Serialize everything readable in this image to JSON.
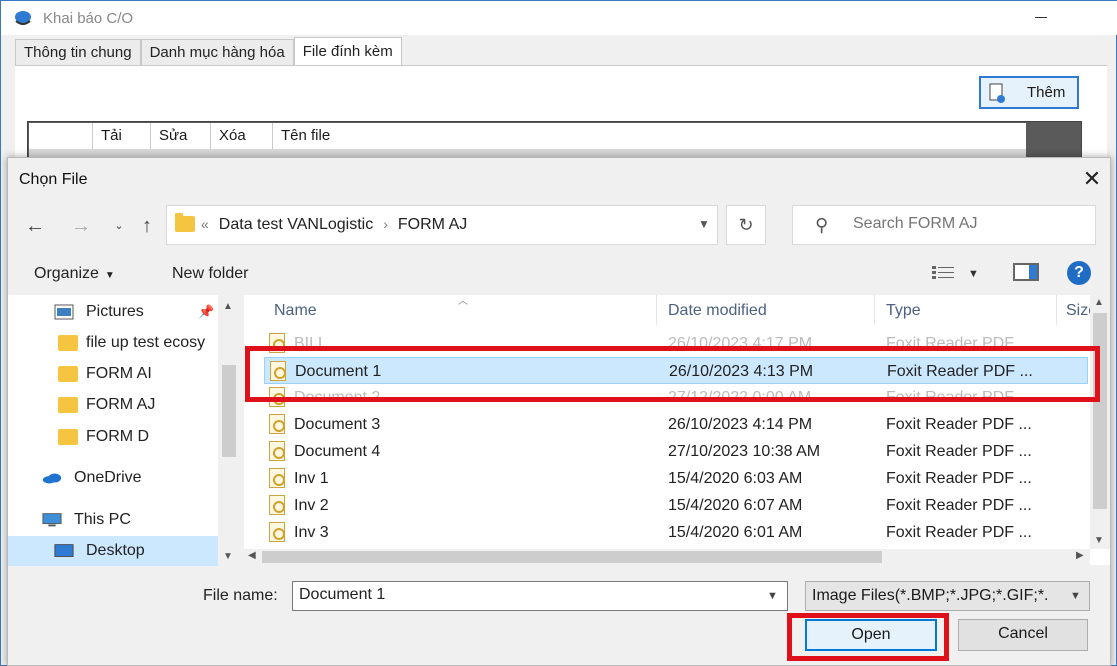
{
  "background_window": {
    "title": "Khai báo C/O",
    "tabs": [
      "Thông tin chung",
      "Danh mục hàng hóa",
      "File đính kèm"
    ],
    "add_button_label": "Thêm",
    "table_headers": [
      "Tải",
      "Sửa",
      "Xóa",
      "Tên file"
    ]
  },
  "dialog": {
    "title": "Chọn File",
    "address": {
      "prefix": "«",
      "parts": [
        "Data test VANLogistic",
        "FORM AJ"
      ],
      "separator": "›"
    },
    "search_placeholder": "Search FORM AJ",
    "toolbar": {
      "organize": "Organize",
      "new_folder": "New folder"
    },
    "nav_items": [
      {
        "label": "Pictures",
        "icon": "pictures-icon",
        "pinned": true
      },
      {
        "label": "file up test ecosy",
        "icon": "folder-icon"
      },
      {
        "label": "FORM AI",
        "icon": "folder-icon"
      },
      {
        "label": "FORM AJ",
        "icon": "folder-icon"
      },
      {
        "label": "FORM D",
        "icon": "folder-icon"
      },
      {
        "label": "OneDrive",
        "icon": "onedrive-icon"
      },
      {
        "label": "This PC",
        "icon": "this-pc-icon"
      },
      {
        "label": "Desktop",
        "icon": "desktop-icon",
        "selected": true
      }
    ],
    "columns": [
      "Name",
      "Date modified",
      "Type",
      "Size"
    ],
    "files": [
      {
        "name": "BILL",
        "date": "26/10/2023 4:17 PM",
        "type": "Foxit Reader PDF ...",
        "faded": true
      },
      {
        "name": "Document 1",
        "date": "26/10/2023 4:13 PM",
        "type": "Foxit Reader PDF ...",
        "selected": true
      },
      {
        "name": "Document 2",
        "date": "27/12/2022 0:00 AM",
        "type": "Foxit Reader PDF ...",
        "faded": true
      },
      {
        "name": "Document 3",
        "date": "26/10/2023 4:14 PM",
        "type": "Foxit Reader PDF ..."
      },
      {
        "name": "Document 4",
        "date": "27/10/2023 10:38 AM",
        "type": "Foxit Reader PDF ..."
      },
      {
        "name": "Inv 1",
        "date": "15/4/2020 6:03 AM",
        "type": "Foxit Reader PDF ..."
      },
      {
        "name": "Inv 2",
        "date": "15/4/2020 6:07 AM",
        "type": "Foxit Reader PDF ..."
      },
      {
        "name": "Inv 3",
        "date": "15/4/2020 6:01 AM",
        "type": "Foxit Reader PDF ..."
      }
    ],
    "file_name_label": "File name:",
    "file_name_value": "Document 1",
    "file_type_value": "Image Files(*.BMP;*.JPG;*.GIF;*.",
    "open_label": "Open",
    "cancel_label": "Cancel"
  },
  "colors": {
    "highlight_red": "#e0101a",
    "selection_blue": "#cce8ff",
    "accent_blue": "#0078d7"
  }
}
